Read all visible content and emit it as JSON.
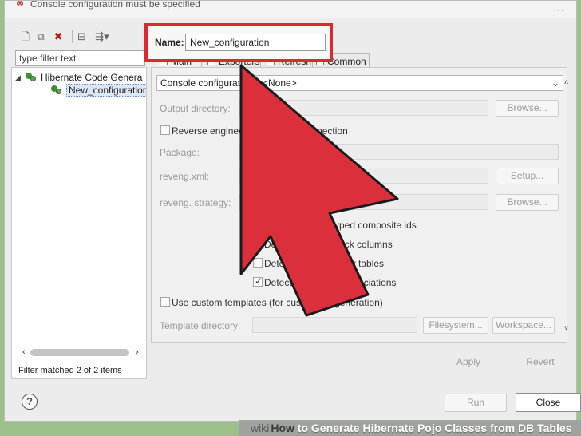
{
  "window": {
    "title_error": "Console configuration must be specified",
    "dots": "..."
  },
  "left": {
    "filter_placeholder": "type filter text",
    "tree": [
      {
        "label": "Hibernate Code Genera",
        "expanded": true
      },
      {
        "label": "New_configuration",
        "selected": true
      }
    ],
    "filtered_status": "Filter matched 2 of 2 items"
  },
  "name": {
    "label": "Name:",
    "value": "New_configuration"
  },
  "tabs": [
    {
      "label": "Main",
      "active": true
    },
    {
      "label": "Exporters"
    },
    {
      "label": "Refresh"
    },
    {
      "label": "Common"
    }
  ],
  "main": {
    "console_configuration_label": "Console configuration:",
    "console_configuration_value": "<None>",
    "output_directory_label": "Output directory:",
    "output_browse": "Browse...",
    "reverse_engineer_label": "Reverse engineer from JDBC Connection",
    "package_label": "Package:",
    "reveng_xml_label": "reveng.xml:",
    "setup_button": "Setup...",
    "reveng_strategy_label": "reveng. strategy:",
    "strategy_browse": "Browse...",
    "composite_ids_label": "Generate basic typed composite ids",
    "detect_columns_label": "Detect optimistic lock columns",
    "detect_tables_label": "Detect many-to-many tables",
    "detect_associations_label": "Detect one-to-one associations",
    "use_templates_label": "Use custom templates (for custom file generation)",
    "template_dir_label": "Template directory:",
    "filesystem_button": "Filesystem...",
    "workspace_button": "Workspace..."
  },
  "actions": {
    "apply": "Apply",
    "revert": "Revert",
    "run": "Run",
    "close": "Close",
    "help": "?"
  },
  "banner": {
    "wiki": "wiki",
    "how": "How",
    "rest": " to Generate Hibernate Pojo Classes from DB Tables"
  },
  "colors": {
    "highlight_red": "#e0262f",
    "arrow_red": "#dc2f3c",
    "background_green": "#9cc08a"
  }
}
